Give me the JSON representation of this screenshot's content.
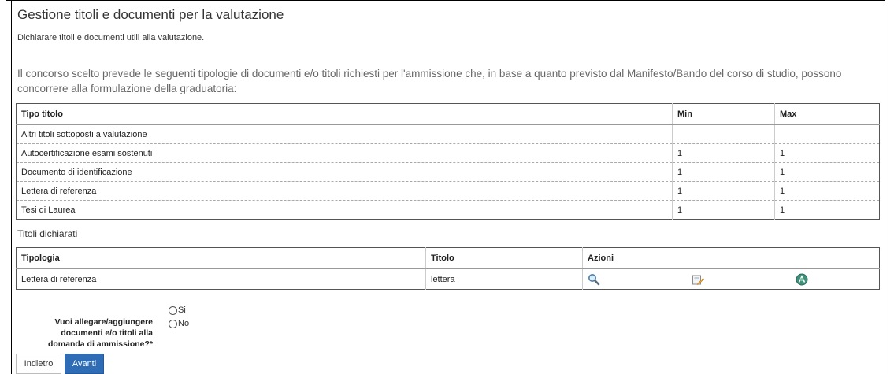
{
  "page": {
    "title": "Gestione titoli e documenti per la valutazione",
    "subtitle": "Dichiarare titoli e documenti utili alla valutazione.",
    "intro": "Il concorso scelto prevede le seguenti tipologie di documenti e/o titoli richiesti per l'ammissione che, in base a quanto previsto dal Manifesto/Bando del corso di studio, possono concorrere alla formulazione della graduatoria:"
  },
  "required_table": {
    "headers": [
      "Tipo titolo",
      "Min",
      "Max"
    ],
    "rows": [
      {
        "tipo": "Altri titoli sottoposti a valutazione",
        "min": "",
        "max": ""
      },
      {
        "tipo": "Autocertificazione esami sostenuti",
        "min": "1",
        "max": "1"
      },
      {
        "tipo": "Documento di identificazione",
        "min": "1",
        "max": "1"
      },
      {
        "tipo": "Lettera di referenza",
        "min": "1",
        "max": "1"
      },
      {
        "tipo": "Tesi di Laurea",
        "min": "1",
        "max": "1"
      }
    ]
  },
  "declared": {
    "section_title": "Titoli dichiarati",
    "headers": [
      "Tipologia",
      "Titolo",
      "Azioni"
    ],
    "rows": [
      {
        "tipologia": "Lettera di referenza",
        "titolo": "lettera",
        "actions": [
          "magnifier-icon",
          "edit-icon",
          "delete-icon"
        ]
      }
    ]
  },
  "question": {
    "label": "Vuoi allegare/aggiungere documenti e/o titoli alla domanda di ammissione?*",
    "options": [
      "Si",
      "No"
    ]
  },
  "buttons": {
    "back": "Indietro",
    "next": "Avanti"
  },
  "colors": {
    "primary_button": "#2e6cb5",
    "intro_text": "#666666"
  }
}
